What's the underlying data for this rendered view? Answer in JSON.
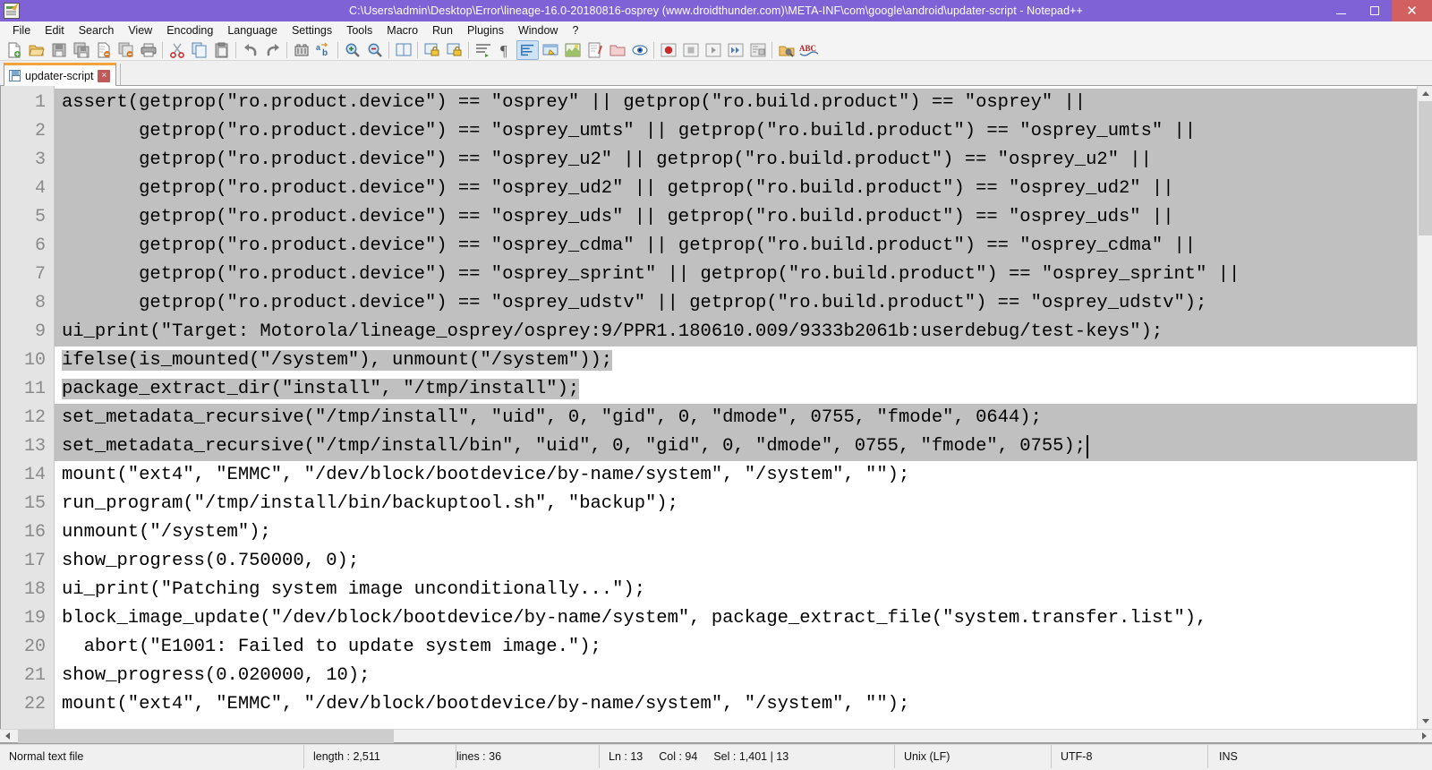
{
  "window": {
    "title": "C:\\Users\\admin\\Desktop\\Error\\lineage-16.0-20180816-osprey (www.droidthunder.com)\\META-INF\\com\\google\\android\\updater-script - Notepad++",
    "icon": "notepad-plus-plus-icon",
    "accent_color": "#7f63d6",
    "close_color": "#d36060",
    "controls": {
      "minimize": "–",
      "maximize": "❐",
      "close": "✕"
    }
  },
  "menu": {
    "items": [
      {
        "label": "File"
      },
      {
        "label": "Edit"
      },
      {
        "label": "Search"
      },
      {
        "label": "View"
      },
      {
        "label": "Encoding"
      },
      {
        "label": "Language"
      },
      {
        "label": "Settings"
      },
      {
        "label": "Tools"
      },
      {
        "label": "Macro"
      },
      {
        "label": "Run"
      },
      {
        "label": "Plugins"
      },
      {
        "label": "Window"
      },
      {
        "label": "?"
      }
    ]
  },
  "toolbar": {
    "buttons": [
      {
        "name": "new-file-icon"
      },
      {
        "name": "open-file-icon"
      },
      {
        "name": "save-icon"
      },
      {
        "name": "save-all-icon"
      },
      {
        "name": "close-file-icon"
      },
      {
        "name": "close-all-files-icon"
      },
      {
        "name": "print-icon"
      },
      {
        "name": "separator"
      },
      {
        "name": "cut-icon"
      },
      {
        "name": "copy-icon"
      },
      {
        "name": "paste-icon"
      },
      {
        "name": "separator"
      },
      {
        "name": "undo-icon"
      },
      {
        "name": "redo-icon"
      },
      {
        "name": "separator"
      },
      {
        "name": "find-icon"
      },
      {
        "name": "replace-icon"
      },
      {
        "name": "separator"
      },
      {
        "name": "zoom-in-icon"
      },
      {
        "name": "zoom-out-icon"
      },
      {
        "name": "separator"
      },
      {
        "name": "sync-vertical-scroll-icon"
      },
      {
        "name": "separator"
      },
      {
        "name": "word-wrap-off-icon"
      },
      {
        "name": "word-wrap-on-icon"
      },
      {
        "name": "separator"
      },
      {
        "name": "show-indent-guide-icon"
      },
      {
        "name": "show-all-characters-icon"
      },
      {
        "name": "show-whitespace-icon"
      },
      {
        "name": "user-defined-dialog-icon"
      },
      {
        "name": "document-map-icon"
      },
      {
        "name": "function-list-icon"
      },
      {
        "name": "folder-as-workspace-icon"
      },
      {
        "name": "monitor-icon"
      },
      {
        "name": "separator"
      },
      {
        "name": "record-macro-icon"
      },
      {
        "name": "stop-recording-icon"
      },
      {
        "name": "play-macro-icon"
      },
      {
        "name": "run-macro-multiple-icon"
      },
      {
        "name": "save-macro-icon"
      },
      {
        "name": "separator"
      },
      {
        "name": "run-icon"
      },
      {
        "name": "spell-check-icon"
      }
    ]
  },
  "tabs": {
    "active": "updater-script",
    "items": [
      {
        "label": "updater-script",
        "icon": "saved-file-icon",
        "close": "×"
      }
    ]
  },
  "editor": {
    "first_visible_line": 1,
    "lines": [
      {
        "no": "1",
        "text": "assert(getprop(\"ro.product.device\") == \"osprey\" || getprop(\"ro.build.product\") == \"osprey\" ||",
        "selected": true
      },
      {
        "no": "2",
        "text": "       getprop(\"ro.product.device\") == \"osprey_umts\" || getprop(\"ro.build.product\") == \"osprey_umts\" ||",
        "selected": true
      },
      {
        "no": "3",
        "text": "       getprop(\"ro.product.device\") == \"osprey_u2\" || getprop(\"ro.build.product\") == \"osprey_u2\" ||",
        "selected": true
      },
      {
        "no": "4",
        "text": "       getprop(\"ro.product.device\") == \"osprey_ud2\" || getprop(\"ro.build.product\") == \"osprey_ud2\" ||",
        "selected": true
      },
      {
        "no": "5",
        "text": "       getprop(\"ro.product.device\") == \"osprey_uds\" || getprop(\"ro.build.product\") == \"osprey_uds\" ||",
        "selected": true
      },
      {
        "no": "6",
        "text": "       getprop(\"ro.product.device\") == \"osprey_cdma\" || getprop(\"ro.build.product\") == \"osprey_cdma\" ||",
        "selected": true
      },
      {
        "no": "7",
        "text": "       getprop(\"ro.product.device\") == \"osprey_sprint\" || getprop(\"ro.build.product\") == \"osprey_sprint\" ||",
        "selected": true
      },
      {
        "no": "8",
        "text": "       getprop(\"ro.product.device\") == \"osprey_udstv\" || getprop(\"ro.build.product\") == \"osprey_udstv\");",
        "selected": true
      },
      {
        "no": "9",
        "text": "ui_print(\"Target: Motorola/lineage_osprey/osprey:9/PPR1.180610.009/9333b2061b:userdebug/test-keys\");",
        "selected": true
      },
      {
        "no": "10",
        "text": "ifelse(is_mounted(\"/system\"), unmount(\"/system\"));",
        "selected": true,
        "sel_chars": 53
      },
      {
        "no": "11",
        "text": "package_extract_dir(\"install\", \"/tmp/install\");",
        "selected": true,
        "sel_chars": 49
      },
      {
        "no": "12",
        "text": "set_metadata_recursive(\"/tmp/install\", \"uid\", 0, \"gid\", 0, \"dmode\", 0755, \"fmode\", 0644);",
        "selected": true
      },
      {
        "no": "13",
        "text": "set_metadata_recursive(\"/tmp/install/bin\", \"uid\", 0, \"gid\", 0, \"dmode\", 0755, \"fmode\", 0755);",
        "selected": true,
        "caret_end": true
      },
      {
        "no": "14",
        "text": "mount(\"ext4\", \"EMMC\", \"/dev/block/bootdevice/by-name/system\", \"/system\", \"\");",
        "selected": false
      },
      {
        "no": "15",
        "text": "run_program(\"/tmp/install/bin/backuptool.sh\", \"backup\");",
        "selected": false
      },
      {
        "no": "16",
        "text": "unmount(\"/system\");",
        "selected": false
      },
      {
        "no": "17",
        "text": "show_progress(0.750000, 0);",
        "selected": false
      },
      {
        "no": "18",
        "text": "ui_print(\"Patching system image unconditionally...\");",
        "selected": false
      },
      {
        "no": "19",
        "text": "block_image_update(\"/dev/block/bootdevice/by-name/system\", package_extract_file(\"system.transfer.list\"),",
        "selected": false
      },
      {
        "no": "20",
        "text": "  abort(\"E1001: Failed to update system image.\");",
        "selected": false
      },
      {
        "no": "21",
        "text": "show_progress(0.020000, 10);",
        "selected": false
      },
      {
        "no": "22",
        "text": "mount(\"ext4\", \"EMMC\", \"/dev/block/bootdevice/by-name/system\", \"/system\", \"\");",
        "selected": false
      }
    ],
    "selection_color": "#c0c0c0",
    "background": "#ffffff",
    "gutter_background": "#e4e4e4"
  },
  "statusbar": {
    "file_type": "Normal text file",
    "length_label": "length : 2,511",
    "lines_label": "lines : 36",
    "ln": "Ln : 13",
    "col": "Col : 94",
    "sel": "Sel : 1,401 | 13",
    "eol": "Unix (LF)",
    "encoding": "UTF-8",
    "insert_mode": "INS"
  }
}
